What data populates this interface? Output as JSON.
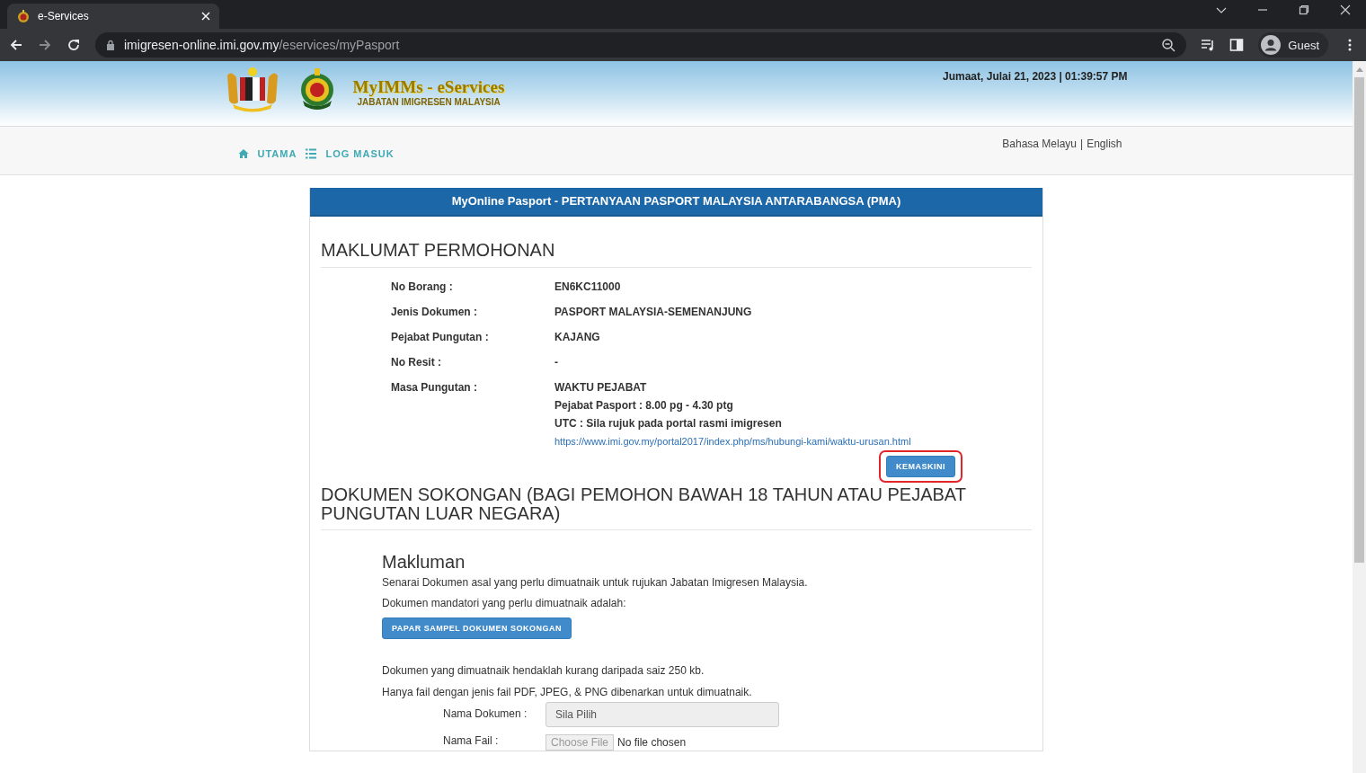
{
  "browser": {
    "tab_title": "e-Services",
    "url_host": "imigresen-online.imi.gov.my",
    "url_path": "/eservices/myPasport",
    "profile": "Guest"
  },
  "header": {
    "logo_title": "MyIMMs - eServices",
    "logo_subtitle": "JABATAN IMIGRESEN MALAYSIA",
    "datetime": "Jumaat, Julai 21, 2023 | 01:39:57 PM"
  },
  "nav": [
    {
      "label": "UTAMA"
    },
    {
      "label": "LOG MASUK"
    }
  ],
  "languages": {
    "items": [
      "Bahasa Melayu",
      "English"
    ],
    "separator": "|"
  },
  "panel_title": "MyOnline Pasport - PERTANYAAN PASPORT MALAYSIA ANTARABANGSA (PMA)",
  "application": {
    "heading": "MAKLUMAT PERMOHONAN",
    "fields": [
      {
        "label": "No Borang :",
        "values": [
          "EN6KC11000"
        ]
      },
      {
        "label": "Jenis Dokumen :",
        "values": [
          "PASPORT MALAYSIA-SEMENANJUNG"
        ]
      },
      {
        "label": "Pejabat Pungutan :",
        "values": [
          "KAJANG"
        ]
      },
      {
        "label": "No Resit :",
        "values": [
          "-"
        ]
      },
      {
        "label": "Masa Pungutan :",
        "values": [
          "WAKTU PEJABAT",
          "Pejabat Pasport : 8.00 pg - 4.30 ptg",
          "UTC : Sila rujuk pada portal rasmi imigresen"
        ],
        "link": "https://www.imi.gov.my/portal2017/index.php/ms/hubungi-kami/waktu-urusan.html"
      }
    ],
    "update_button": "KEMASKINI",
    "update_highlighted": true
  },
  "documents": {
    "heading": "DOKUMEN SOKONGAN (BAGI PEMOHON BAWAH 18 TAHUN ATAU PEJABAT PUNGUTAN LUAR NEGARA)",
    "notice_title": "Makluman",
    "lines": [
      "Senarai Dokumen asal yang perlu dimuatnaik untuk rujukan Jabatan Imigresen Malaysia.",
      "Dokumen mandatori yang perlu dimuatnaik adalah:"
    ],
    "sample_button": "PAPAR SAMPEL DOKUMEN SOKONGAN",
    "rules": [
      "Dokumen yang dimuatnaik hendaklah kurang daripada saiz 250 kb.",
      "Hanya fail dengan jenis fail PDF, JPEG, & PNG dibenarkan untuk dimuatnaik."
    ],
    "form": [
      {
        "kind": "select",
        "label": "Nama Dokumen :",
        "value": "Sila Pilih"
      },
      {
        "kind": "file",
        "label": "Nama Fail :",
        "button": "Choose File",
        "status": "No file chosen"
      }
    ]
  }
}
